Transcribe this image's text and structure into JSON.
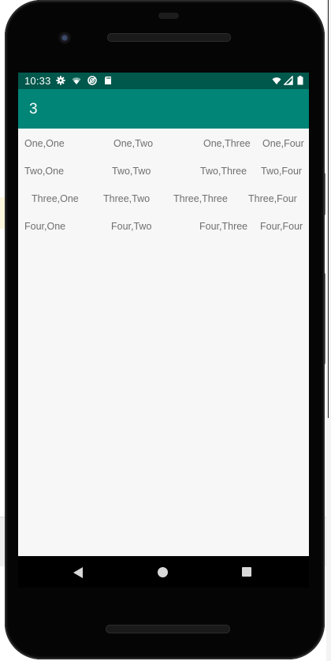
{
  "status_bar": {
    "time": "10:33",
    "icons": [
      "gear-icon",
      "wifi-icon",
      "do-not-disturb-icon",
      "sd-card-icon",
      "wifi-x-icon",
      "signal-icon",
      "battery-icon"
    ],
    "background": "#00574b"
  },
  "app_bar": {
    "title": "3",
    "background": "#008577"
  },
  "grid": {
    "rows": [
      [
        "One,One",
        "One,Two",
        "One,Three",
        "One,Four"
      ],
      [
        "Two,One",
        "Two,Two",
        "Two,Three",
        "Two,Four"
      ],
      [
        "Three,One",
        "Three,Two",
        "Three,Three",
        "Three,Four"
      ],
      [
        "Four,One",
        "Four,Two",
        "Four,Three",
        "Four,Four"
      ]
    ],
    "text_color": "#6f6f6f",
    "background": "#f8f7f8"
  },
  "nav_bar": {
    "icons": [
      "back-icon",
      "home-icon",
      "recents-icon"
    ]
  }
}
